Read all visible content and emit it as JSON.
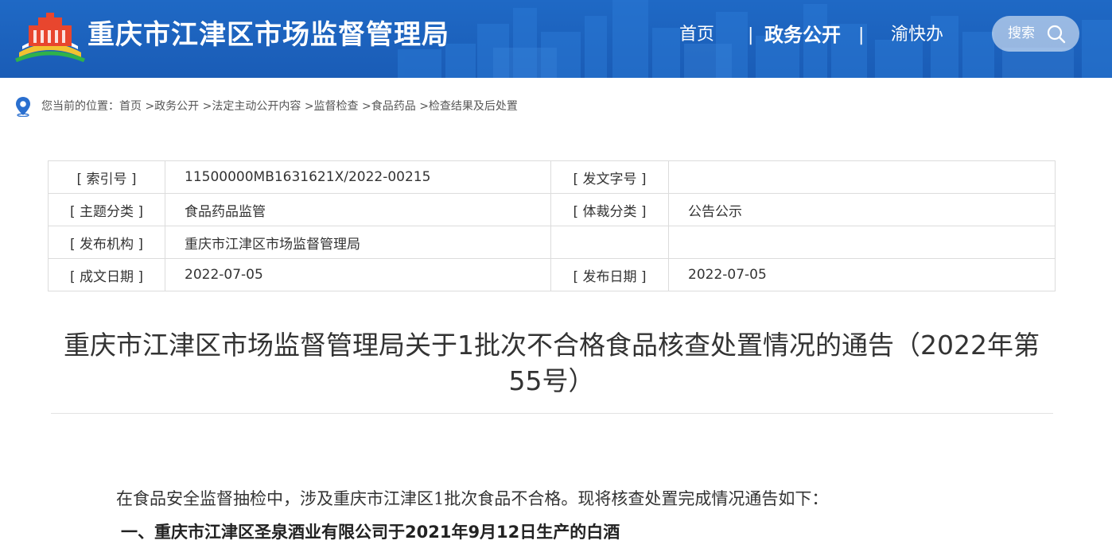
{
  "header": {
    "site_title": "重庆市江津区市场监督管理局",
    "nav": [
      {
        "label": "首页"
      },
      {
        "label": "政务公开"
      },
      {
        "label": "渝快办"
      }
    ],
    "search_label": "搜索",
    "colors": {
      "bg": "#1a5cb6",
      "text": "#ffffff"
    }
  },
  "breadcrumb": {
    "prefix": "您当前的位置：",
    "items": [
      "首页",
      ">政务公开",
      ">法定主动公开内容",
      ">监督检查",
      ">食品药品",
      ">检查结果及后处置"
    ]
  },
  "meta": {
    "rows": [
      {
        "k1": "[ 索引号 ]",
        "v1": "11500000MB1631621X/2022-00215",
        "k2": "[ 发文字号 ]",
        "v2": ""
      },
      {
        "k1": "[ 主题分类 ]",
        "v1": "食品药品监管",
        "k2": "[ 体裁分类 ]",
        "v2": "公告公示"
      },
      {
        "k1": "[ 发布机构 ]",
        "v1": "重庆市江津区市场监督管理局",
        "k2": "",
        "v2": ""
      },
      {
        "k1": "[ 成文日期 ]",
        "v1": "2022-07-05",
        "k2": "[ 发布日期 ]",
        "v2": "2022-07-05"
      }
    ]
  },
  "article": {
    "title": "重庆市江津区市场监督管理局关于1批次不合格食品核查处置情况的通告（2022年第55号）",
    "paragraph1": "在食品安全监督抽检中，涉及重庆市江津区1批次食品不合格。现将核查处置完成情况通告如下：",
    "heading1": "一、重庆市江津区圣泉酒业有限公司于2021年9月12日生产的白酒"
  },
  "icons": {
    "logo": "city-emblem-logo",
    "search": "search-icon",
    "location": "location-pin-icon"
  }
}
